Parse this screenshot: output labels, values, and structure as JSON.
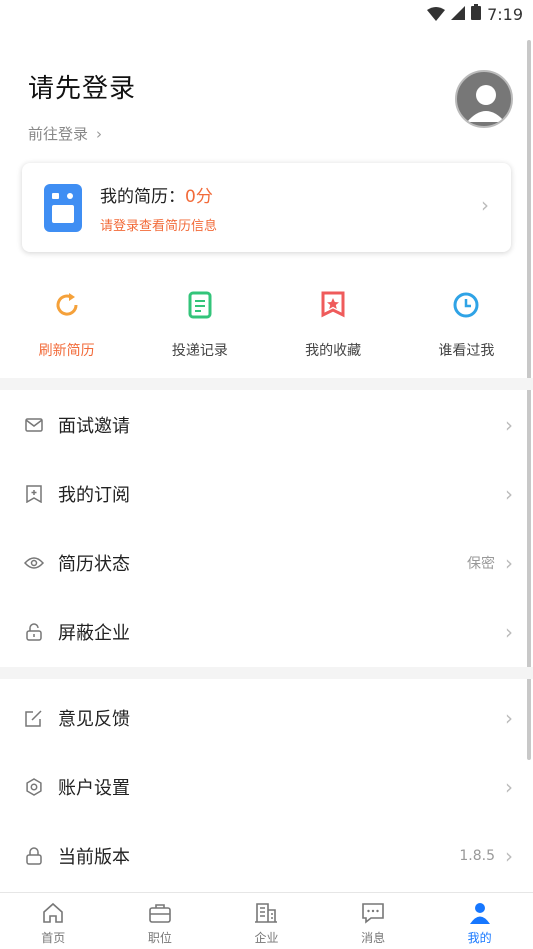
{
  "status": {
    "time": "7:19"
  },
  "header": {
    "title": "请先登录",
    "login_link": "前往登录"
  },
  "resume_card": {
    "label": "我的简历：",
    "score": "0分",
    "hint": "请登录查看简历信息"
  },
  "quick_actions": [
    {
      "label": "刷新简历",
      "icon": "refresh-icon",
      "color": "#f5a13a"
    },
    {
      "label": "投递记录",
      "icon": "document-icon",
      "color": "#33c47a"
    },
    {
      "label": "我的收藏",
      "icon": "bookmark-star-icon",
      "color": "#ef5b5b"
    },
    {
      "label": "谁看过我",
      "icon": "clock-icon",
      "color": "#2fa3e6"
    }
  ],
  "menu_group1": [
    {
      "label": "面试邀请",
      "icon": "mail-icon",
      "value": ""
    },
    {
      "label": "我的订阅",
      "icon": "subscribe-icon",
      "value": ""
    },
    {
      "label": "简历状态",
      "icon": "eye-icon",
      "value": "保密"
    },
    {
      "label": "屏蔽企业",
      "icon": "unlock-icon",
      "value": ""
    }
  ],
  "menu_group2": [
    {
      "label": "意见反馈",
      "icon": "edit-icon",
      "value": ""
    },
    {
      "label": "账户设置",
      "icon": "settings-icon",
      "value": ""
    },
    {
      "label": "当前版本",
      "icon": "lock-icon",
      "value": "1.8.5"
    }
  ],
  "tabbar": [
    {
      "label": "首页",
      "icon": "home-icon"
    },
    {
      "label": "职位",
      "icon": "briefcase-icon"
    },
    {
      "label": "企业",
      "icon": "building-icon"
    },
    {
      "label": "消息",
      "icon": "message-icon"
    },
    {
      "label": "我的",
      "icon": "profile-icon",
      "active": true
    }
  ],
  "colors": {
    "accent": "#f26b3a",
    "active_tab": "#1677ff"
  }
}
